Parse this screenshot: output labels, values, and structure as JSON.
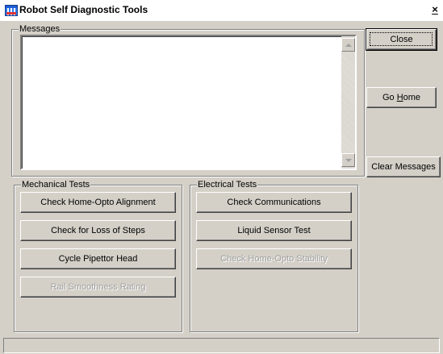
{
  "window": {
    "title": "Robot Self Diagnostic Tools",
    "close_glyph": "×"
  },
  "messages": {
    "label": "Messages",
    "content": ""
  },
  "side_buttons": {
    "close": "Close",
    "go_home_prefix": "Go ",
    "go_home_mnemonic": "H",
    "go_home_suffix": "ome",
    "clear_messages": "Clear Messages"
  },
  "mechanical_tests": {
    "label": "Mechanical Tests",
    "buttons": [
      {
        "label": "Check Home-Opto Alignment",
        "enabled": true
      },
      {
        "label": "Check for Loss of Steps",
        "enabled": true
      },
      {
        "label": "Cycle Pipettor Head",
        "enabled": true
      },
      {
        "label": "Rail Smoothness Rating",
        "enabled": false
      }
    ]
  },
  "electrical_tests": {
    "label": "Electrical Tests",
    "buttons": [
      {
        "label": "Check Communications",
        "enabled": true
      },
      {
        "label": "Liquid Sensor Test",
        "enabled": true
      },
      {
        "label": "Check Home-Opto Stability",
        "enabled": false
      }
    ]
  },
  "status_bar": {
    "text": ""
  },
  "icons": {
    "app": "robot-app-icon",
    "close": "close-icon",
    "scroll_up": "scroll-up-arrow-icon",
    "scroll_down": "scroll-down-arrow-icon"
  },
  "colors": {
    "face": "#d4d0c8",
    "disabled_text": "#a0a0a0",
    "title_icon": "#1f5fd6"
  }
}
